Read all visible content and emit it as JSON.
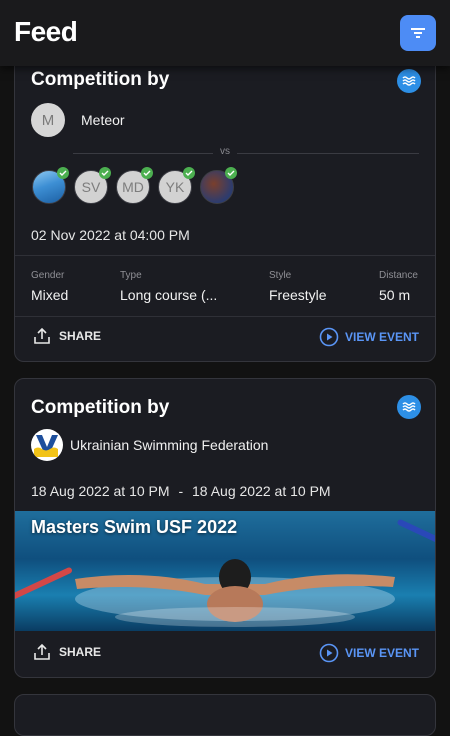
{
  "header": {
    "title": "Feed",
    "filter_icon": "filter-icon",
    "accent": "#4d8cf5"
  },
  "cards": [
    {
      "title": "Competition by",
      "sport_icon": "swimming-icon",
      "organizer": {
        "initial": "M",
        "name": "Meteor"
      },
      "vs_label": "vs",
      "participants": [
        {
          "initials": "",
          "verified": true
        },
        {
          "initials": "SV",
          "verified": true
        },
        {
          "initials": "MD",
          "verified": true
        },
        {
          "initials": "YK",
          "verified": true
        },
        {
          "initials": "",
          "verified": true
        }
      ],
      "date": "02 Nov 2022 at 04:00 PM",
      "details": {
        "gender_label": "Gender",
        "gender": "Mixed",
        "type_label": "Type",
        "type": "Long course (...",
        "style_label": "Style",
        "style": "Freestyle",
        "distance_label": "Distance",
        "distance": "50 m"
      },
      "share_label": "SHARE",
      "view_label": "VIEW EVENT"
    },
    {
      "title": "Competition by",
      "sport_icon": "swimming-icon",
      "organizer": {
        "name": "Ukrainian Swimming Federation"
      },
      "date_start": "18 Aug 2022 at 10 PM",
      "date_sep": "-",
      "date_end": "18 Aug 2022 at 10 PM",
      "banner_title": "Masters Swim USF 2022",
      "share_label": "SHARE",
      "view_label": "VIEW EVENT"
    }
  ],
  "colors": {
    "card_bg": "#1b1c22",
    "link": "#5a95f5",
    "verified": "#4caf50",
    "sport": "#2d8fe6"
  }
}
